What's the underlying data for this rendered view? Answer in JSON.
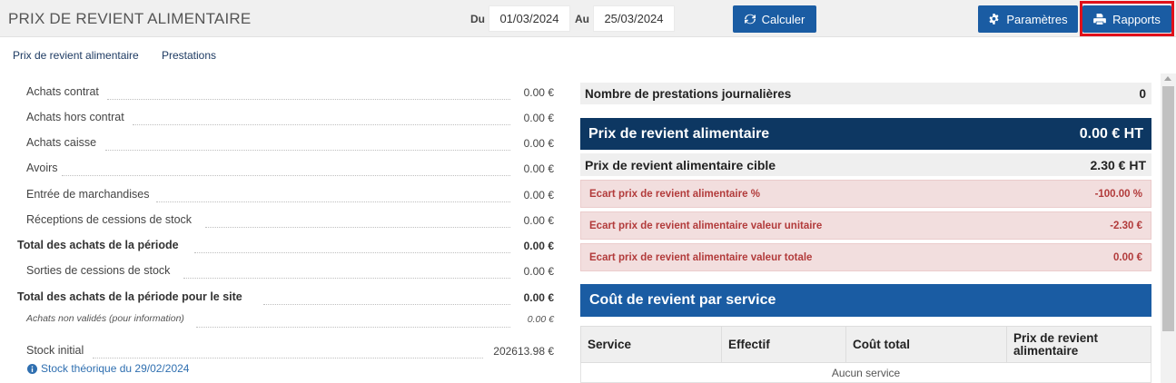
{
  "header": {
    "title": "PRIX DE REVIENT ALIMENTAIRE",
    "from_label": "Du",
    "from_value": "01/03/2024",
    "to_label": "Au",
    "to_value": "25/03/2024",
    "calculate_label": "Calculer",
    "settings_label": "Paramètres",
    "reports_label": "Rapports",
    "highlight_color": "#e0101a",
    "accent_color": "#1a5ca3"
  },
  "tabs": [
    {
      "label": "Prix de revient alimentaire"
    },
    {
      "label": "Prestations"
    }
  ],
  "left_rows": [
    {
      "label": "Achats contrat",
      "value": "0.00 €"
    },
    {
      "label": "Achats hors contrat",
      "value": "0.00 €"
    },
    {
      "label": "Achats caisse",
      "value": "0.00 €"
    },
    {
      "label": "Avoirs",
      "value": "0.00 €"
    },
    {
      "label": "Entrée de marchandises",
      "value": "0.00 €"
    },
    {
      "label": "Réceptions de cessions de stock",
      "value": "0.00 €"
    },
    {
      "label": "Total des achats de la période",
      "value": "0.00 €"
    },
    {
      "label": "Sorties de cessions de stock",
      "value": "0.00 €"
    },
    {
      "label": "Total des achats de la période pour le site",
      "value": "0.00 €"
    },
    {
      "label": "Achats non validés (pour information)",
      "value": "0.00 €"
    },
    {
      "label": "Stock initial",
      "value": "202613.98 €"
    }
  ],
  "stock_link": "Stock théorique du 29/02/2024",
  "right": {
    "nb_prestations_label": "Nombre de prestations journalières",
    "nb_prestations_value": "0",
    "prix_label": "Prix de revient alimentaire",
    "prix_value": "0.00 € HT",
    "cible_label": "Prix de revient alimentaire cible",
    "cible_value": "2.30 € HT",
    "ecart_pct_label": "Ecart prix de revient alimentaire %",
    "ecart_pct_value": "-100.00 %",
    "ecart_unit_label": "Ecart prix de revient alimentaire valeur unitaire",
    "ecart_unit_value": "-2.30 €",
    "ecart_total_label": "Ecart prix de revient alimentaire valeur totale",
    "ecart_total_value": "0.00 €",
    "service_title": "Coût de revient par service",
    "columns": [
      "Service",
      "Effectif",
      "Coût total",
      "Prix de revient alimentaire"
    ],
    "empty_text": "Aucun service"
  }
}
